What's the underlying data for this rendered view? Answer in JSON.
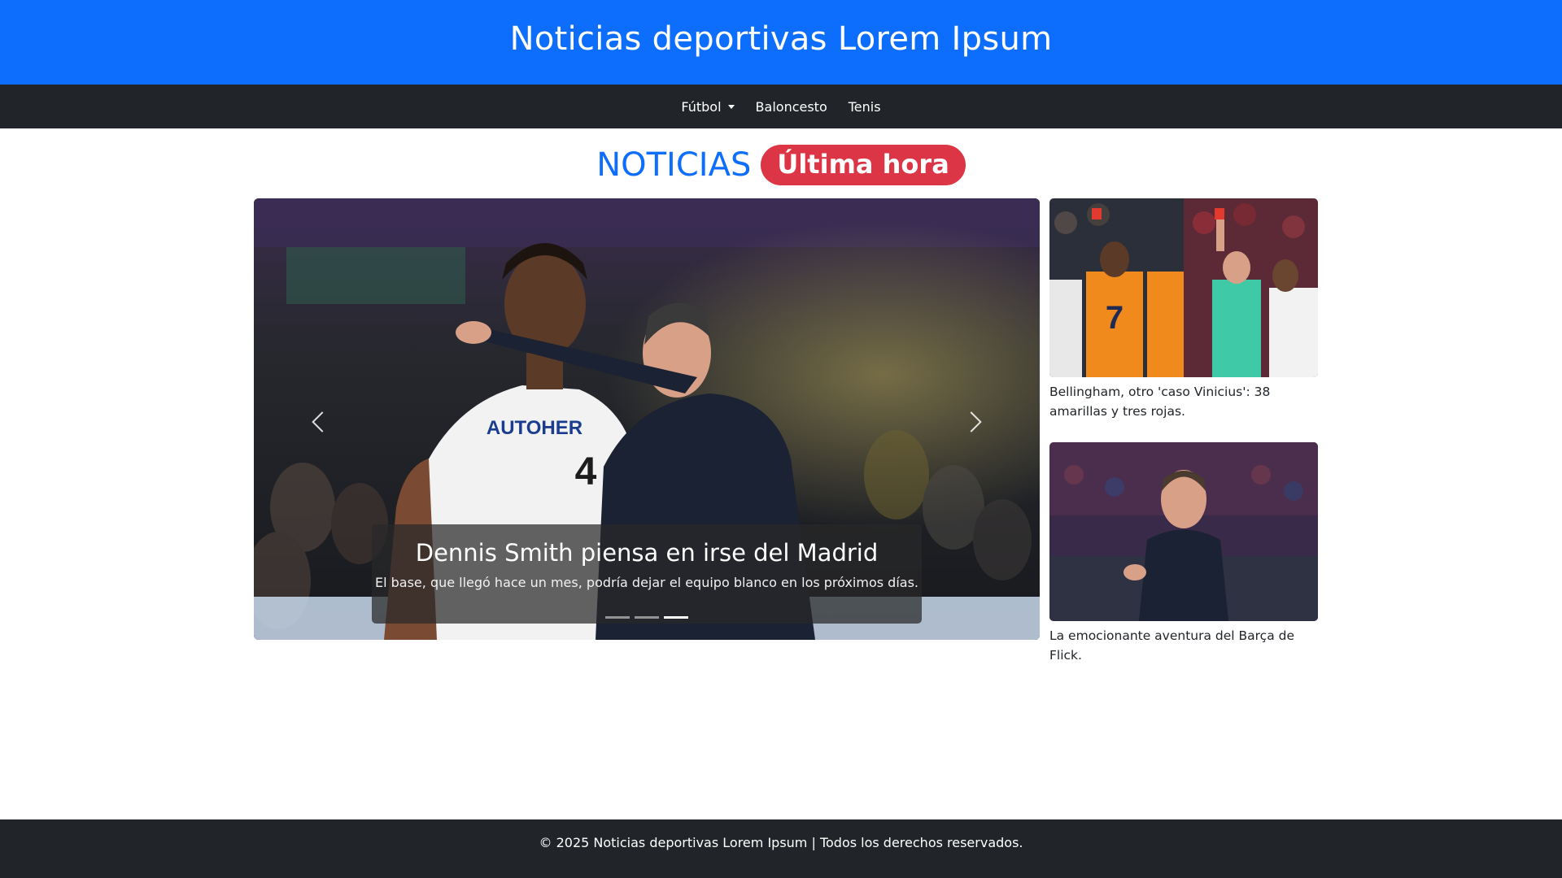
{
  "header": {
    "title": "Noticias deportivas Lorem Ipsum"
  },
  "nav": {
    "items": [
      {
        "label": "Fútbol",
        "dropdown": true
      },
      {
        "label": "Baloncesto"
      },
      {
        "label": "Tenis"
      }
    ]
  },
  "section": {
    "title": "NOTICIAS",
    "badge": "Última hora"
  },
  "carousel": {
    "slide_title": "Dennis Smith piensa en irse del Madrid",
    "slide_text": "El base, que llegó hace un mes, podría dejar el equipo blanco en los próximos días.",
    "indicator_count": 3,
    "active_indicator": 3,
    "jersey_number": "4",
    "sponsor": "AUTOHER"
  },
  "side_news": [
    {
      "caption": "Bellingham, otro 'caso Vinicius': 38 amarillas y tres rojas."
    },
    {
      "caption": "La emocionante aventura del Barça de Flick."
    }
  ],
  "footer": {
    "text": "© 2025 Noticias deportivas Lorem Ipsum | Todos los derechos reservados."
  },
  "colors": {
    "primary": "#0d6efd",
    "dark": "#212529",
    "danger": "#dc3545"
  },
  "icons": {
    "prev": "chevron-left-icon",
    "next": "chevron-right-icon",
    "dropdown": "caret-down-icon"
  }
}
